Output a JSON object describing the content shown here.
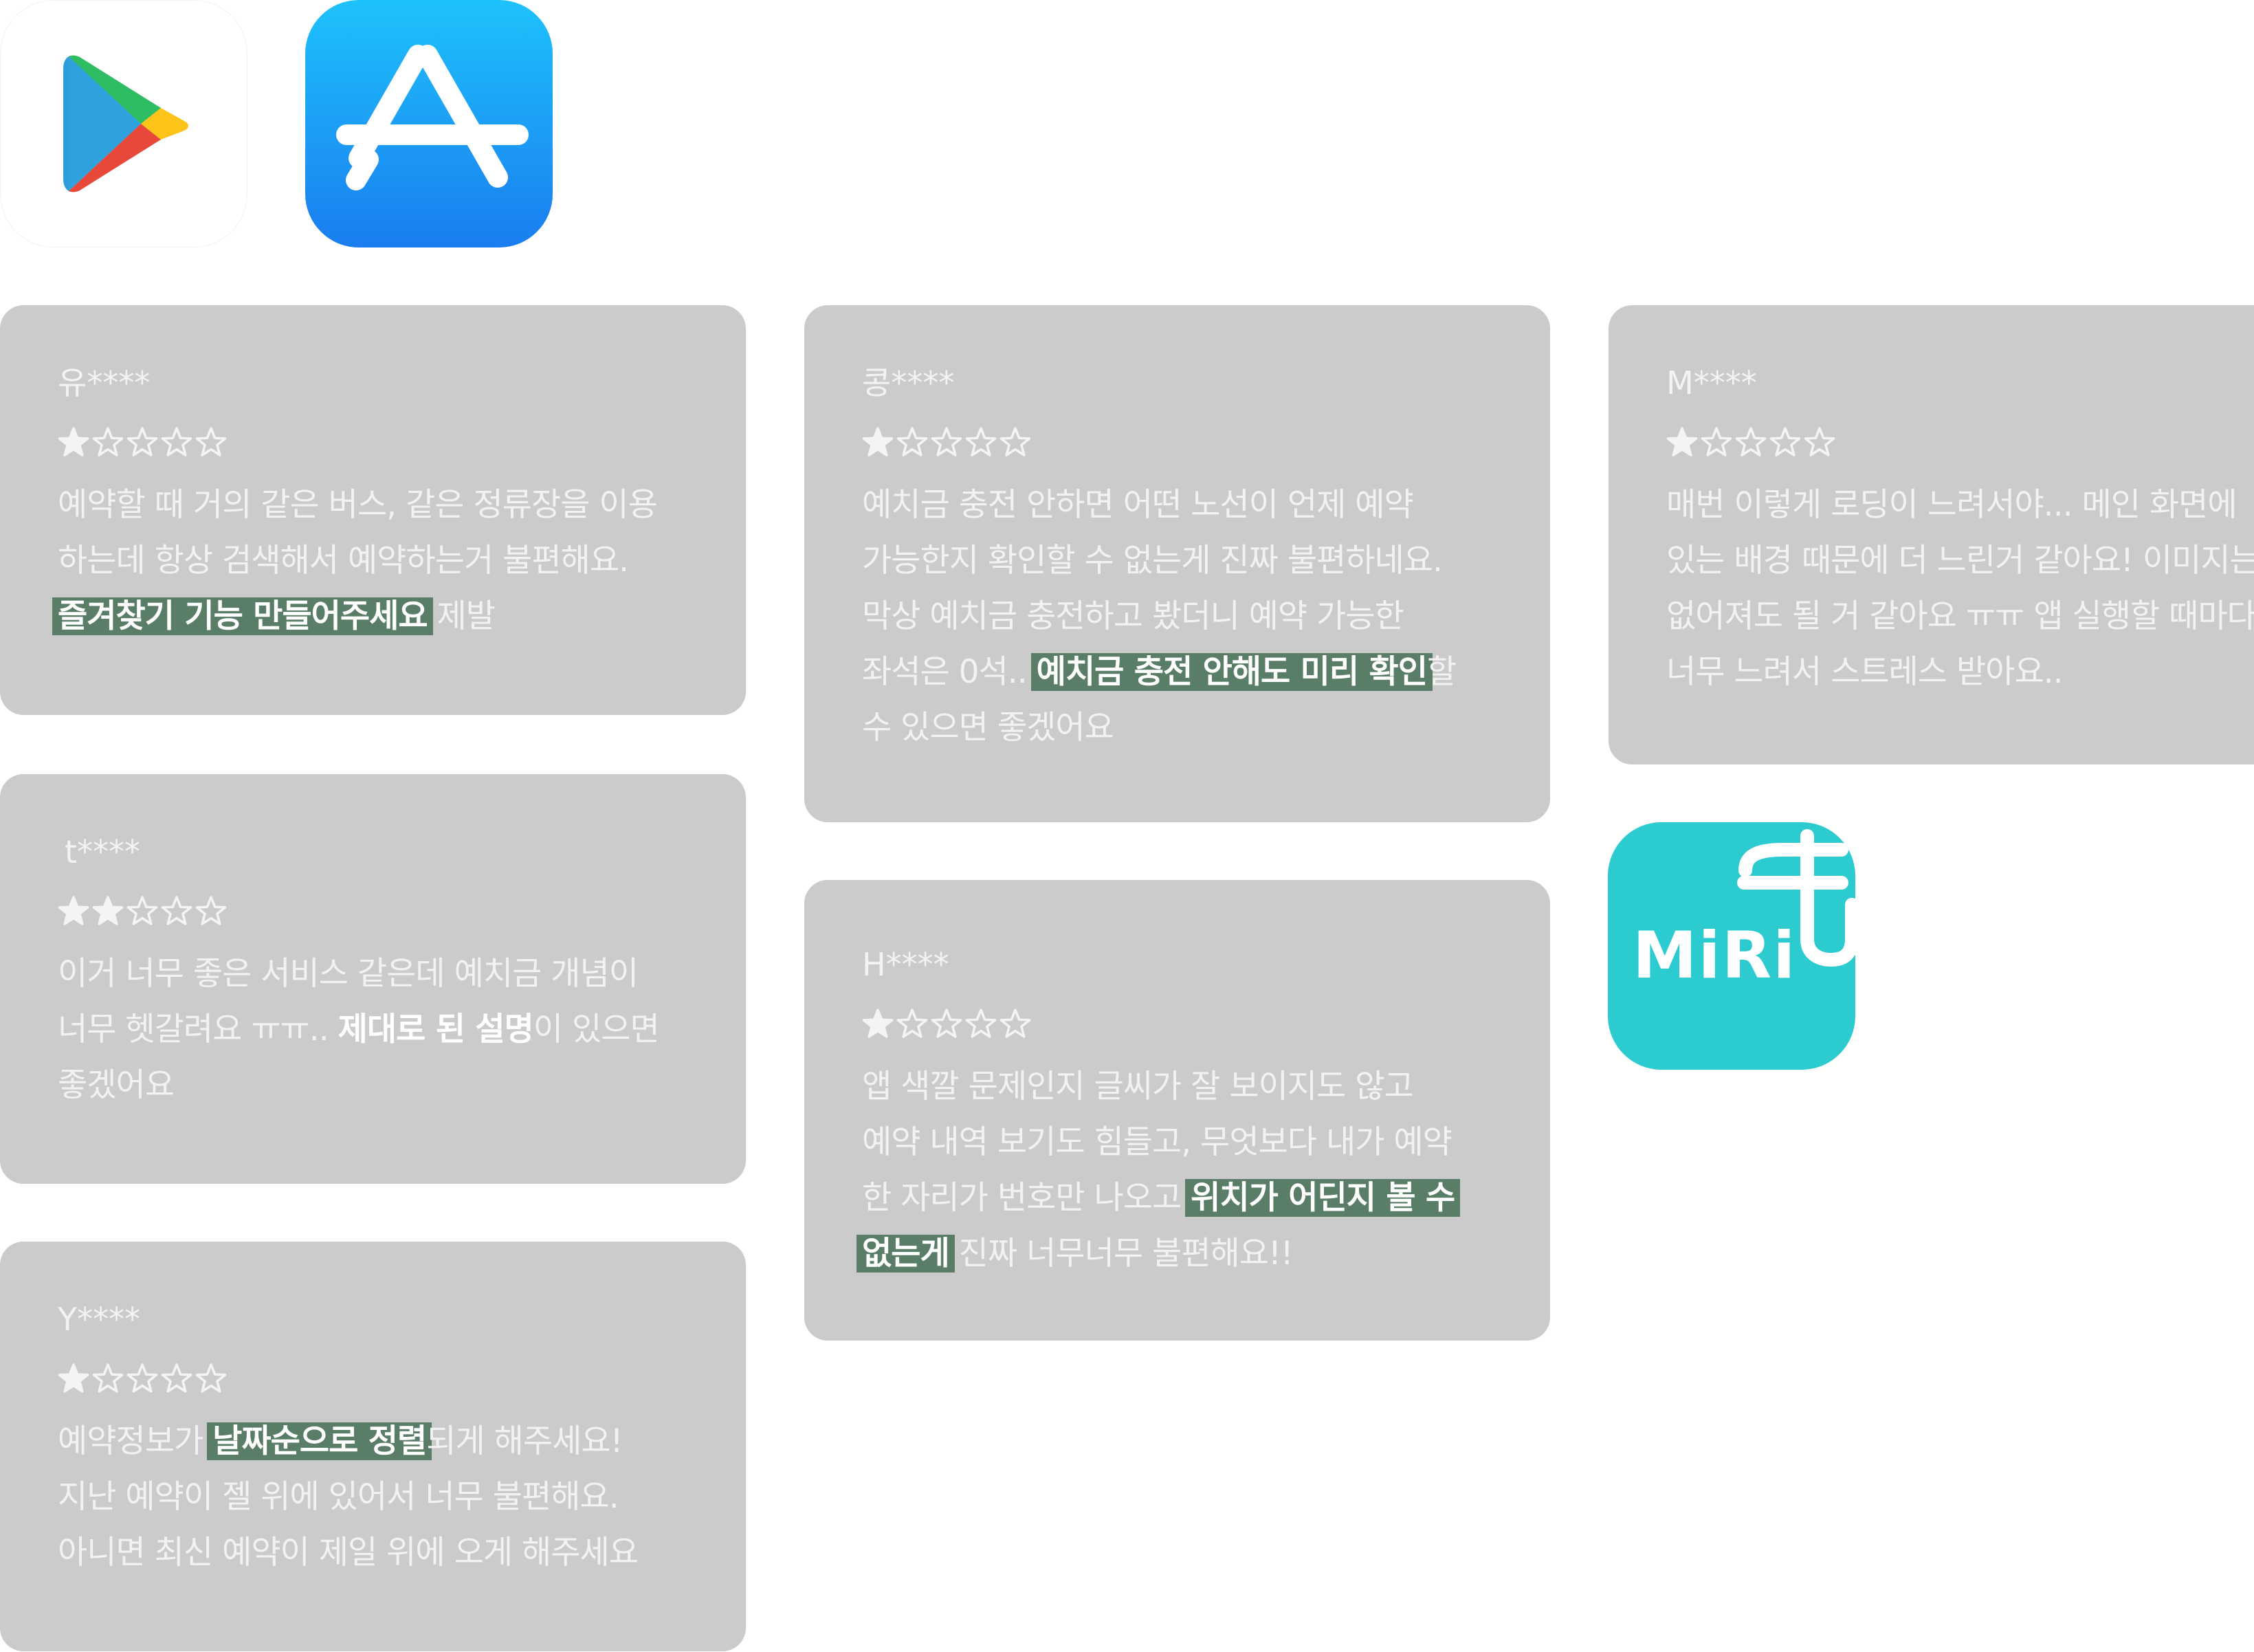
{
  "app_icons": [
    {
      "name": "google-play-icon"
    },
    {
      "name": "app-store-icon"
    },
    {
      "name": "miri-app-icon",
      "label": "MiRi"
    }
  ],
  "colors": {
    "card_bg": "#cbcbcb",
    "highlight": "#5a7d68",
    "miri_brand": "#2ccbcf",
    "appstore_top": "#1ec2fb",
    "appstore_bottom": "#1a7df0"
  },
  "reviews": [
    {
      "user": "유****",
      "rating": 1,
      "lines": [
        [
          {
            "t": "예약할 때 거의 같은 버스, 같은 정류장을 이용"
          }
        ],
        [
          {
            "t": "하는데 항상 검색해서 예약하는거 불편해요."
          }
        ],
        [
          {
            "t": "즐겨찾기 기능 만들어주세요",
            "hl": true
          },
          {
            "t": " 제발"
          }
        ]
      ]
    },
    {
      "user": "t****",
      "rating": 2,
      "lines": [
        [
          {
            "t": "이거 너무 좋은 서비스 같은데 예치금 개념이"
          }
        ],
        [
          {
            "t": "너무 헷갈려요 ㅠㅠ.. "
          },
          {
            "t": "제대로 된 설명",
            "b": true
          },
          {
            "t": "이 있으면"
          }
        ],
        [
          {
            "t": "좋겠어요"
          }
        ]
      ]
    },
    {
      "user": "Y****",
      "rating": 1,
      "lines": [
        [
          {
            "t": "예약정보가 "
          },
          {
            "t": "날짜순으로 정렬",
            "hl": true
          },
          {
            "t": "되게 해주세요!"
          }
        ],
        [
          {
            "t": "지난 예약이 젤 위에 있어서 너무 불편해요."
          }
        ],
        [
          {
            "t": "아니면 최신 예약이 제일 위에 오게 해주세요"
          }
        ]
      ]
    },
    {
      "user": "콩****",
      "rating": 1,
      "lines": [
        [
          {
            "t": "예치금 충전 안하면 어떤 노선이 언제 예약"
          }
        ],
        [
          {
            "t": "가능한지 확인할 수 없는게 진짜 불편하네요."
          }
        ],
        [
          {
            "t": "막상 예치금 충전하고 봤더니 예약 가능한"
          }
        ],
        [
          {
            "t": "좌석은 0석.. "
          },
          {
            "t": "예치금 충전 안해도 미리 확인",
            "hl": true
          },
          {
            "t": "할"
          }
        ],
        [
          {
            "t": "수 있으면 좋겠어요"
          }
        ]
      ]
    },
    {
      "user": "H****",
      "rating": 1,
      "lines": [
        [
          {
            "t": "앱 색깔 문제인지 글씨가 잘 보이지도 않고"
          }
        ],
        [
          {
            "t": "예약 내역 보기도 힘들고, 무엇보다 내가 예약"
          }
        ],
        [
          {
            "t": "한 자리가 번호만 나오고 "
          },
          {
            "t": "위치가 어딘지 볼 수",
            "hl": true
          }
        ],
        [
          {
            "t": "없는게",
            "hl": true
          },
          {
            "t": " 진짜 너무너무 불편해요!!"
          }
        ]
      ]
    },
    {
      "user": "M****",
      "rating": 1,
      "lines": [
        [
          {
            "t": "매번 이렇게 로딩이 느려서야... 메인 화면에"
          }
        ],
        [
          {
            "t": "있는 배경 때문에 더 느린거 같아요! 이미지는"
          }
        ],
        [
          {
            "t": "없어져도 될 거 같아요 ㅠㅠ 앱 실행할 때마다"
          }
        ],
        [
          {
            "t": "너무 느려서 스트레스 받아요.."
          }
        ]
      ]
    }
  ]
}
